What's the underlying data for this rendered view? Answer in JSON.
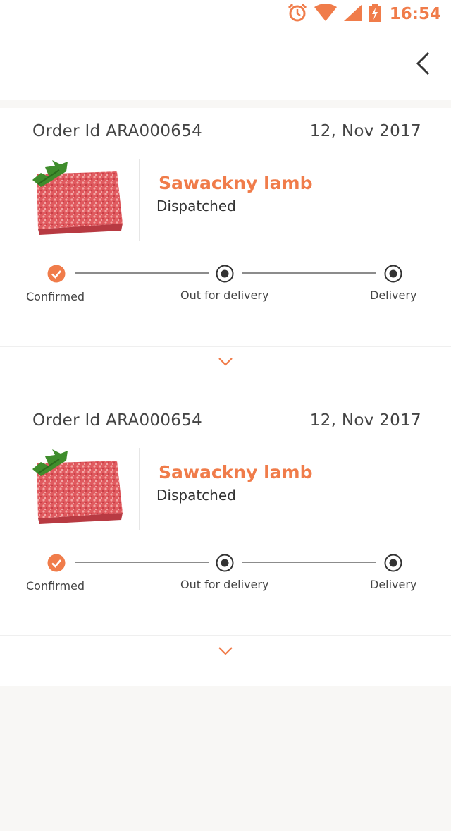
{
  "status_bar": {
    "time": "16:54",
    "icons": [
      "alarm-icon",
      "wifi-icon",
      "signal-icon",
      "battery-charging-icon"
    ],
    "accent": "#f07c4a"
  },
  "header": {
    "back_icon": "chevron-left-icon"
  },
  "colors": {
    "accent": "#f07c4a",
    "text": "#444444",
    "line": "#8c8c8c",
    "background": "#f8f7f5"
  },
  "orders": [
    {
      "order_id": "Order Id ARA000654",
      "date": "12, Nov 2017",
      "product_name": "Sawackny lamb",
      "product_status": "Dispatched",
      "image_icon": "minced-meat-image",
      "steps": [
        {
          "label": "Confirmed",
          "state": "done"
        },
        {
          "label": "Out for delivery",
          "state": "pending"
        },
        {
          "label": "Delivery",
          "state": "pending"
        }
      ]
    },
    {
      "order_id": "Order Id ARA000654",
      "date": "12, Nov 2017",
      "product_name": "Sawackny lamb",
      "product_status": "Dispatched",
      "image_icon": "minced-meat-image",
      "steps": [
        {
          "label": "Confirmed",
          "state": "done"
        },
        {
          "label": "Out for delivery",
          "state": "pending"
        },
        {
          "label": "Delivery",
          "state": "pending"
        }
      ]
    }
  ]
}
